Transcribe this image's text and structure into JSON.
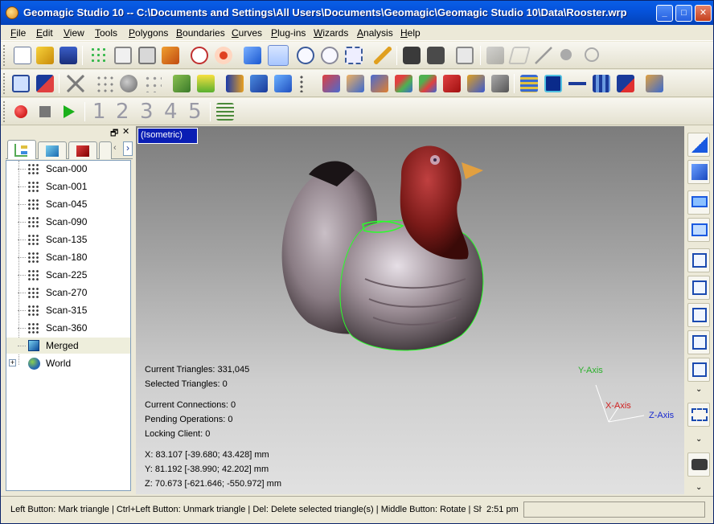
{
  "window": {
    "title": "Geomagic Studio 10 -- C:\\Documents and Settings\\All Users\\Documents\\Geomagic\\Geomagic Studio 10\\Data\\Rooster.wrp",
    "minimize": "_",
    "maximize": "□",
    "close": "✕"
  },
  "menu": [
    "File",
    "Edit",
    "View",
    "Tools",
    "Polygons",
    "Boundaries",
    "Curves",
    "Plug-ins",
    "Wizards",
    "Analysis",
    "Help"
  ],
  "toolbar3": {
    "numbers": [
      "1",
      "2",
      "3",
      "4",
      "5"
    ]
  },
  "panel": {
    "float_icon": "🗗",
    "close_icon": "✕",
    "prev": "‹",
    "next": "›"
  },
  "tree": {
    "items": [
      "Scan-000",
      "Scan-001",
      "Scan-045",
      "Scan-090",
      "Scan-135",
      "Scan-180",
      "Scan-225",
      "Scan-270",
      "Scan-315",
      "Scan-360",
      "Merged",
      "World"
    ],
    "expander": "+"
  },
  "viewport": {
    "view_label": "(Isometric)",
    "stats": {
      "current_triangles": "Current Triangles: 331,045",
      "selected_triangles": "Selected Triangles: 0",
      "current_connections": "Current Connections: 0",
      "pending_operations": "Pending Operations: 0",
      "locking_client": "Locking Client: 0",
      "x": "X: 83.107 [-39.680; 43.428] mm",
      "y": "Y: 81.192 [-38.990; 42.202] mm",
      "z": "Z: 70.673 [-621.646; -550.972] mm"
    },
    "axes": {
      "y": "Y-Axis",
      "x": "X-Axis",
      "z": "Z-Axis"
    }
  },
  "status": {
    "text": "Left Button: Mark triangle | Ctrl+Left Button: Unmark triangle | Del: Delete selected triangle(s) | Middle Button: Rotate | Shift+Ri",
    "time": "2:51 pm"
  },
  "colors": {
    "title_blue": "#0553dc",
    "view_label_bg": "#0a1eb4",
    "boundary_green": "#2aff2a",
    "rooster_red": "#8c1c1a"
  }
}
